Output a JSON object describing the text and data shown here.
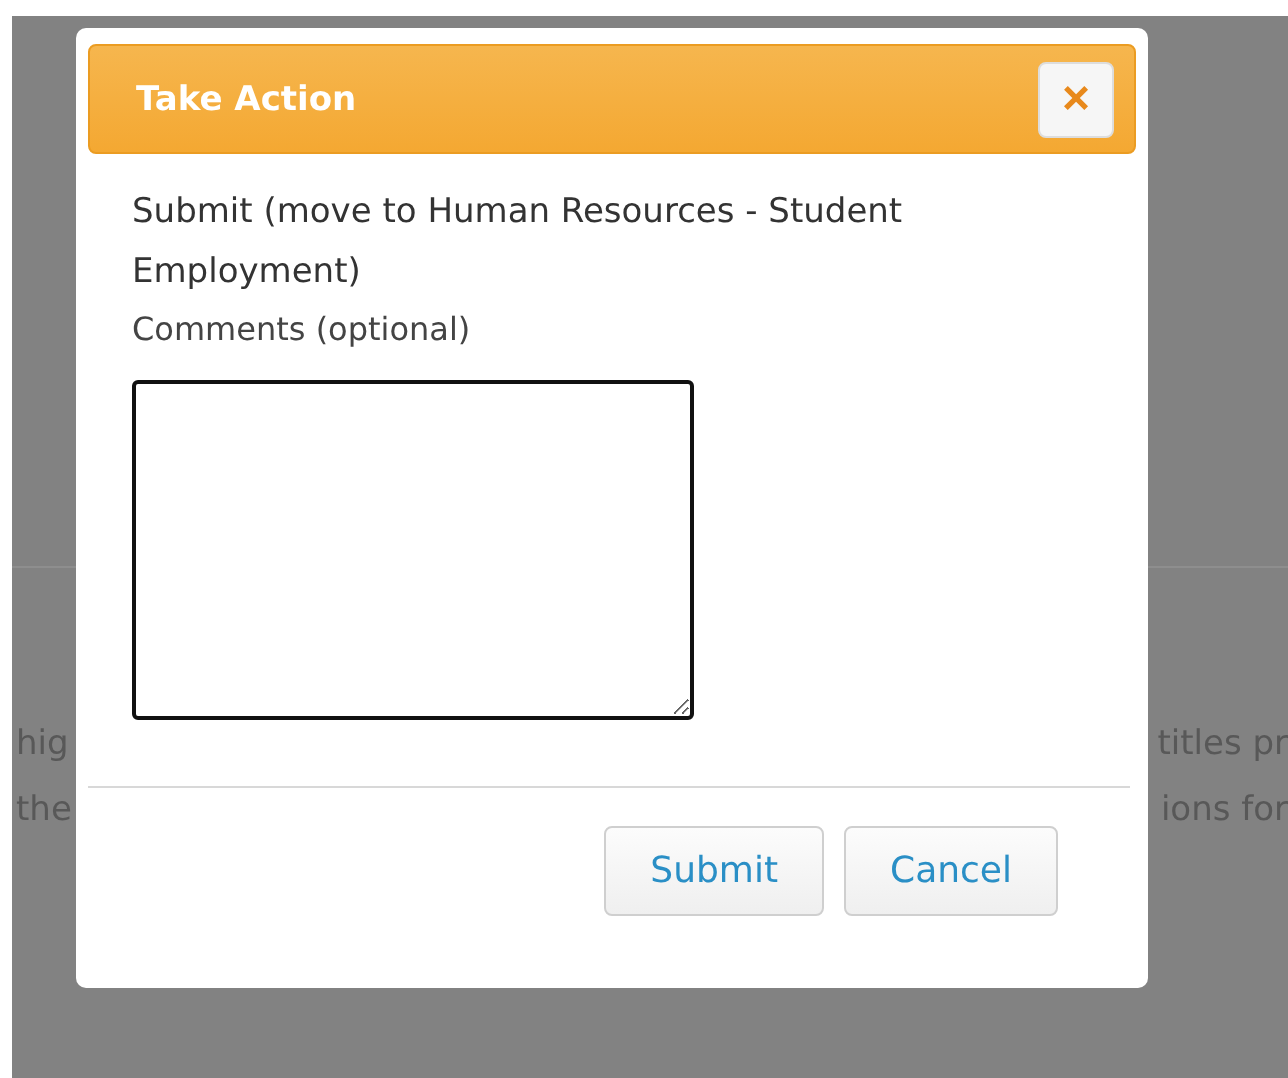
{
  "background": {
    "lines": [
      {
        "left": "hig",
        "right": "titles pr"
      },
      {
        "left": "the",
        "right": "ions for"
      }
    ]
  },
  "dialog": {
    "title": "Take Action",
    "close": "×",
    "message": "Submit (move to Human Resources - Student Employment)",
    "comments": {
      "label": "Comments (optional)"
    },
    "buttons": [
      {
        "label": "Submit"
      },
      {
        "label": "Cancel"
      }
    ]
  }
}
